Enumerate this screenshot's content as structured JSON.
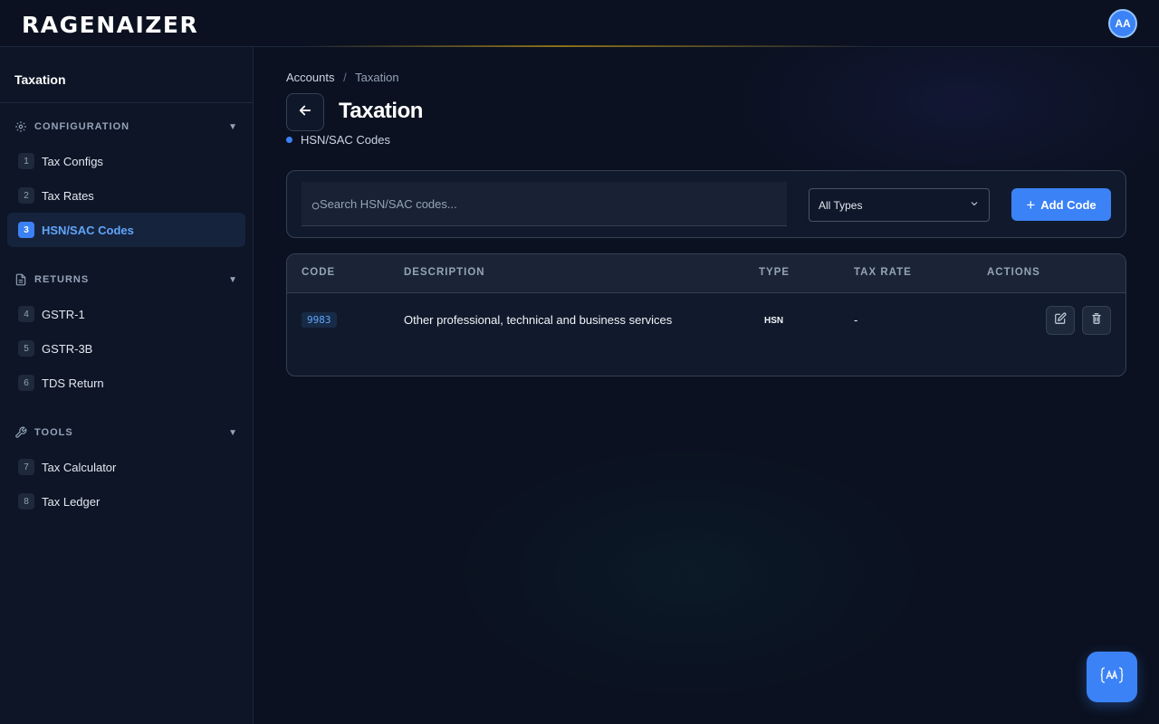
{
  "header": {
    "logo": "RAGENAIZER",
    "avatar_initials": "AA"
  },
  "sidebar": {
    "title": "Taxation",
    "sections": [
      {
        "label": "CONFIGURATION",
        "icon": "gear-icon",
        "items": [
          {
            "num": "1",
            "label": "Tax Configs"
          },
          {
            "num": "2",
            "label": "Tax Rates"
          },
          {
            "num": "3",
            "label": "HSN/SAC Codes",
            "active": true
          }
        ]
      },
      {
        "label": "RETURNS",
        "icon": "document-icon",
        "items": [
          {
            "num": "4",
            "label": "GSTR-1"
          },
          {
            "num": "5",
            "label": "GSTR-3B"
          },
          {
            "num": "6",
            "label": "TDS Return"
          }
        ]
      },
      {
        "label": "TOOLS",
        "icon": "wrench-icon",
        "items": [
          {
            "num": "7",
            "label": "Tax Calculator"
          },
          {
            "num": "8",
            "label": "Tax Ledger"
          }
        ]
      }
    ]
  },
  "main": {
    "breadcrumb": {
      "root": "Accounts",
      "separator": "/",
      "current": "Taxation"
    },
    "title": "Taxation",
    "subtitle": "HSN/SAC Codes",
    "search": {
      "placeholder": "Search HSN/SAC codes...",
      "value": ""
    },
    "type_filter": {
      "selected": "All Types"
    },
    "add_button": "Add Code",
    "table": {
      "columns": [
        "CODE",
        "DESCRIPTION",
        "TYPE",
        "TAX RATE",
        "ACTIONS"
      ],
      "rows": [
        {
          "code": "9983",
          "description": "Other professional, technical and business services",
          "type": "HSN",
          "tax_rate": "-"
        }
      ]
    }
  },
  "colors": {
    "accent": "#3b82f6",
    "background": "#0b1120",
    "sidebar": "#0d1526"
  }
}
